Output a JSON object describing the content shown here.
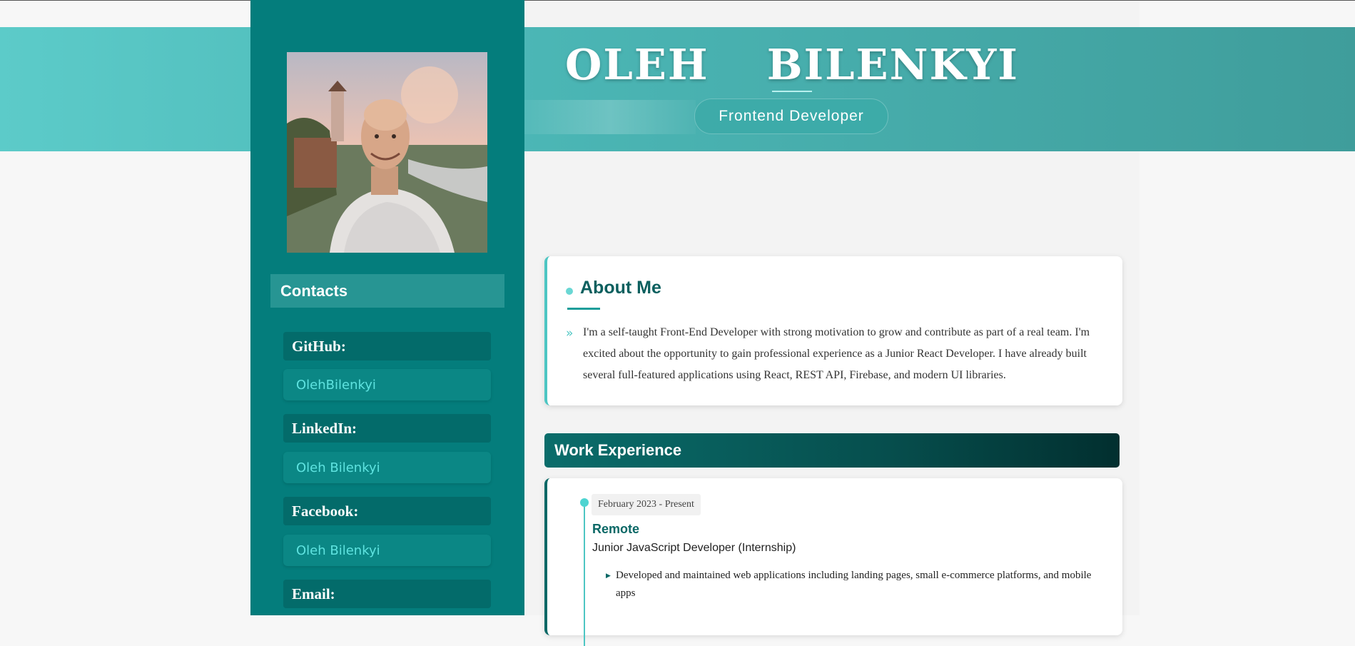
{
  "header": {
    "name": "OLEH  BILENKYI",
    "role": "Frontend Developer"
  },
  "sidebar": {
    "contacts_title": "Contacts",
    "contacts": [
      {
        "label": "GitHub:",
        "value": "OlehBilenkyi"
      },
      {
        "label": "LinkedIn:",
        "value": "Oleh Bilenkyi"
      },
      {
        "label": "Facebook:",
        "value": "Oleh Bilenkyi"
      },
      {
        "label": "Email:",
        "value": ""
      }
    ]
  },
  "about": {
    "title": "About Me",
    "chevron": "»",
    "text": "I'm a self-taught Front-End Developer with strong motivation to grow and contribute as part of a real team. I'm excited about the opportunity to gain professional experience as a Junior React Developer. I have already built several full-featured applications using React, REST API, Firebase, and modern UI libraries."
  },
  "work": {
    "title": "Work Experience",
    "jobs": [
      {
        "date": "February 2023 - Present",
        "location": "Remote",
        "position": "Junior JavaScript Developer (Internship)",
        "bullets": [
          "Developed and maintained web applications including landing pages, small e-commerce platforms, and mobile apps"
        ]
      }
    ]
  },
  "colors": {
    "sidebar": "#047d7c",
    "accent": "#4dc6c3",
    "banner_start": "#5ccbc9",
    "banner_end": "#3f9d9b"
  }
}
